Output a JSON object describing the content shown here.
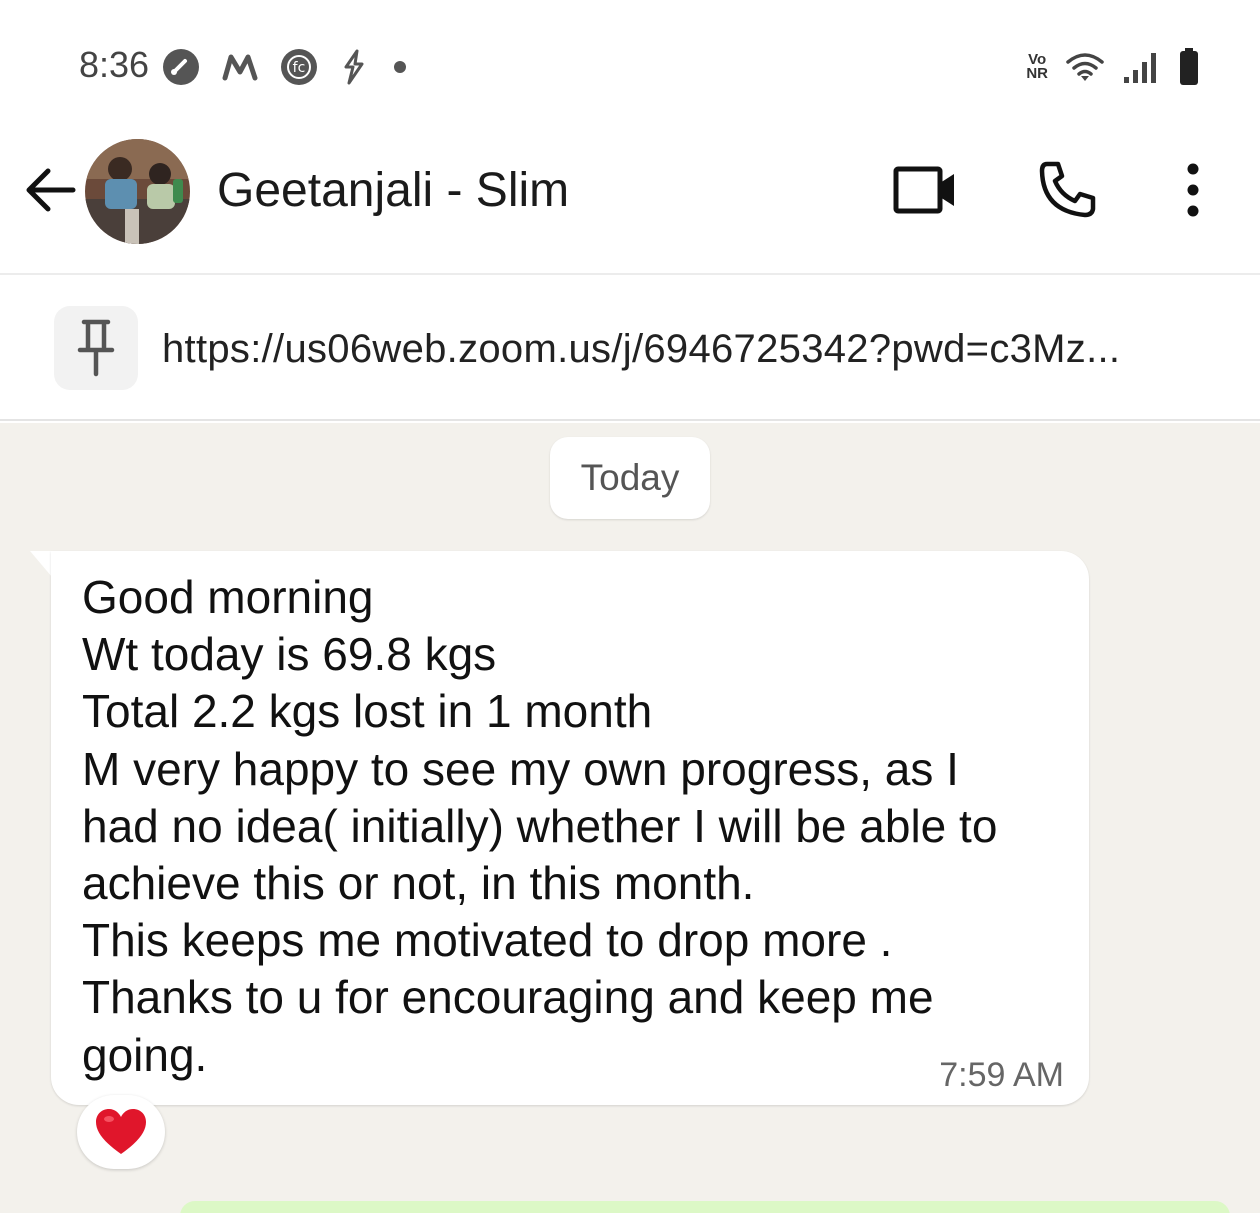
{
  "status_bar": {
    "time": "8:36",
    "left_icons": [
      "speedometer-icon",
      "m-logo-icon",
      "fc-logo-icon",
      "bolt-icon",
      "dot-icon"
    ],
    "network_label_top": "Vo",
    "network_label_bottom": "NR",
    "right_icons": [
      "wifi-icon",
      "signal-icon",
      "battery-icon"
    ]
  },
  "header": {
    "contact_name": "Geetanjali - Slim",
    "icons": [
      "back-arrow-icon",
      "video-call-icon",
      "voice-call-icon",
      "more-options-icon"
    ]
  },
  "pinned": {
    "icon": "pin-icon",
    "text": "https://us06web.zoom.us/j/6946725342?pwd=c3Mz..."
  },
  "chat": {
    "date_label": "Today",
    "messages": [
      {
        "lines": [
          "Good morning",
          "Wt today is 69.8 kgs",
          "Total 2.2 kgs lost in 1 month",
          "M very happy to see my own progress, as I",
          "had no idea( initially) whether I will be able to",
          "achieve this or not, in this month.",
          "This keeps me motivated to drop more .",
          "Thanks to u for encouraging and keep me",
          "going."
        ],
        "time": "7:59 AM",
        "reaction": "❤️"
      }
    ]
  },
  "colors": {
    "chat_background": "#f3f1ec",
    "bubble_incoming": "#ffffff",
    "bubble_outgoing": "#dcf8c6",
    "reaction_heart": "#e0162b"
  }
}
